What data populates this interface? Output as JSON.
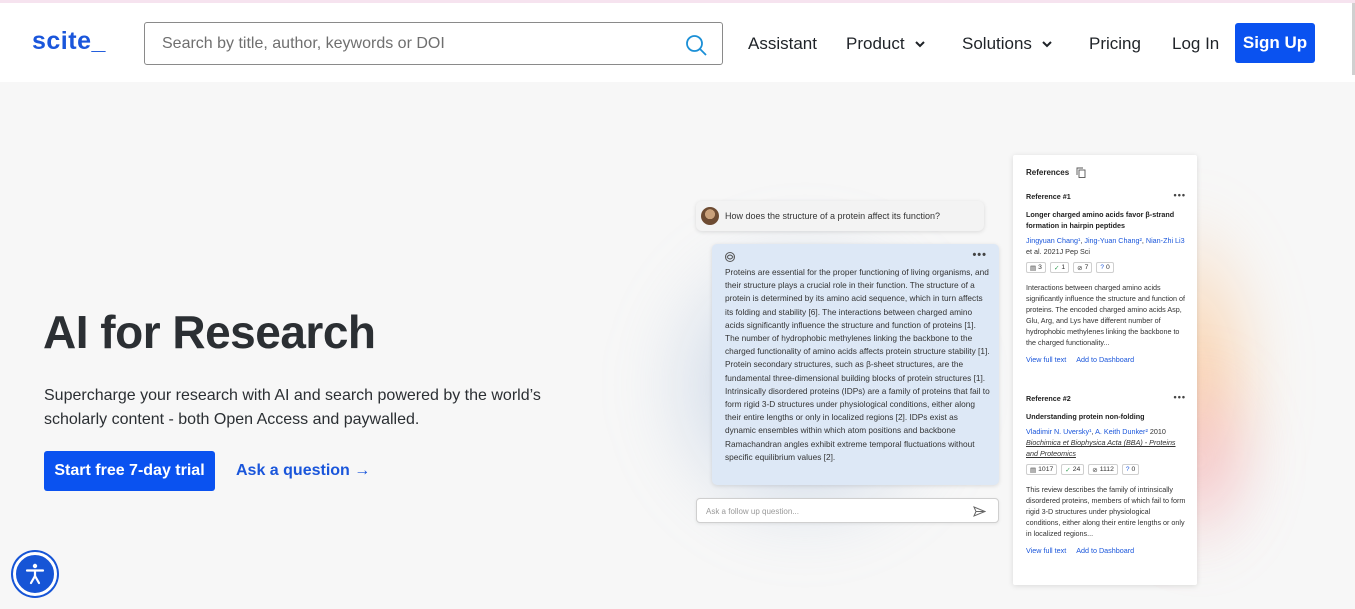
{
  "nav": {
    "logo": "scite_",
    "search_placeholder": "Search by title, author, keywords or DOI",
    "assistant": "Assistant",
    "product": "Product",
    "solutions": "Solutions",
    "pricing": "Pricing",
    "login": "Log In",
    "signup": "Sign Up"
  },
  "hero": {
    "title": "AI for Research",
    "subtitle": "Supercharge your research with AI and search powered by the world’s scholarly content - both Open Access and paywalled.",
    "trial_button": "Start free 7-day trial",
    "ask_link": "Ask a question →"
  },
  "chat": {
    "question": "How does the structure of a protein affect its function?",
    "more": "•••",
    "answer": "Proteins are essential for the proper functioning of living organisms, and their structure plays a crucial role in their function. The structure of a protein is determined by its amino acid sequence, which in turn affects its folding and stability [6]. The interactions between charged amino acids significantly influence the structure and function of proteins [1]. The number of hydrophobic methylenes linking the backbone to the charged functionality of amino acids affects protein structure stability [1]. Protein secondary structures, such as β-sheet structures, are the fundamental three-dimensional building blocks of protein structures [1]. Intrinsically disordered proteins (IDPs) are a family of proteins that fail to form rigid 3-D structures under physiological conditions, either along their entire lengths or only in localized regions [2]. IDPs exist as dynamic ensembles within which atom positions and backbone Ramachandran angles exhibit extreme temporal fluctuations without specific equilibrium values [2].",
    "followup_placeholder": "Ask a follow up question..."
  },
  "references": {
    "header": "References",
    "items": [
      {
        "label": "Reference #1",
        "more": "•••",
        "title": "Longer charged amino acids favor β-strand formation in hairpin peptides",
        "authors": [
          "Jingyuan Chang¹",
          "Jing-Yuan Chang²",
          "Nian-Zhi Li3"
        ],
        "suffix": " et al. 2021J Pep Sci",
        "journal": "",
        "stats": [
          "3",
          "1",
          "7",
          "0"
        ],
        "abstract": "Interactions between charged amino acids significantly influence the structure and function of proteins. The encoded charged amino acids Asp, Glu, Arg, and Lys have different number of hydrophobic methylenes linking the backbone to the charged functionality...",
        "view_link": "View full text",
        "dashboard_link": "Add to Dashboard"
      },
      {
        "label": "Reference #2",
        "more": "•••",
        "title": "Understanding protein non-folding",
        "authors": [
          "Vladimir N. Uversky¹",
          "A. Keith Dunker²"
        ],
        "suffix": " 2010",
        "journal": "Biochimica et Biophysica Acta (BBA) - Proteins and Proteomics",
        "stats": [
          "1017",
          "24",
          "1112",
          "0"
        ],
        "abstract": "This review describes the family of intrinsically disordered proteins, members of which fail to form rigid 3-D structures under physiological conditions, either along their entire lengths or only in localized regions...",
        "view_link": "View full text",
        "dashboard_link": "Add to Dashboard"
      }
    ]
  },
  "colors": {
    "brand_blue": "#0a52f0",
    "link_blue": "#1a56db"
  }
}
